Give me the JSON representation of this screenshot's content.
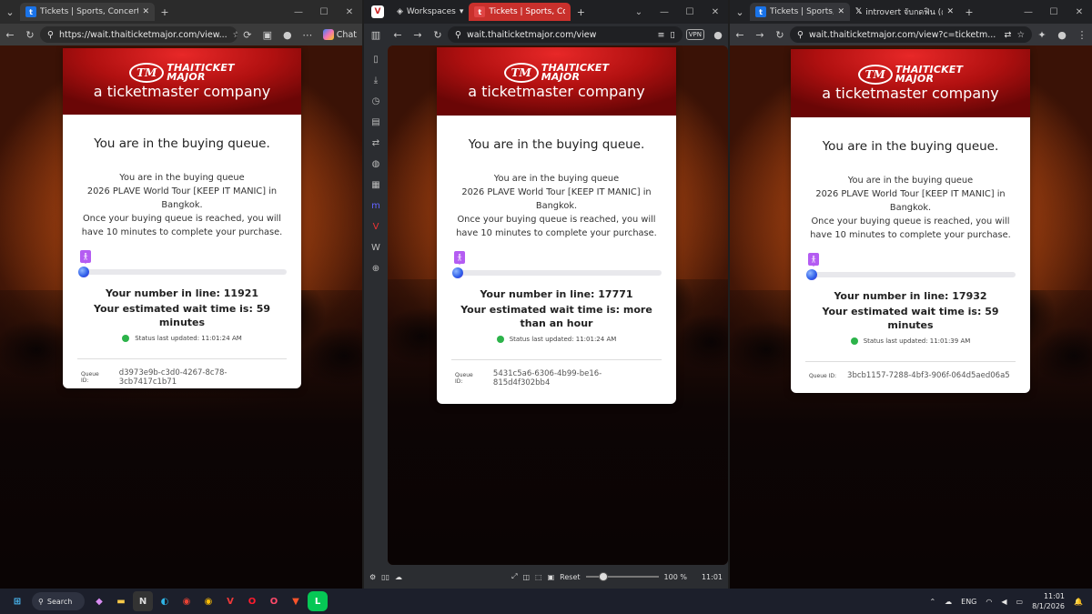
{
  "windows": [
    {
      "id": "edge",
      "tab_title": "Tickets | Sports, Concerts, Festivals",
      "url": "https://wait.thaiticketmajor.com/view...",
      "chat_label": "Chat",
      "queue": {
        "logo_name_line1": "THAITICKET",
        "logo_name_line2": "MAJOR",
        "logo_sub": "a ticketmaster company",
        "title": "You are in the buying queue.",
        "line1": "You are in the buying queue",
        "line2": "2026 PLAVE World Tour [KEEP IT MANIC] in Bangkok.",
        "line3": "Once your buying queue is reached, you will have 10 minutes to complete your purchase.",
        "number_label": "Your number in line: 11921",
        "wait_label": "Your estimated wait time is: 59 minutes",
        "status": "Status last updated: 11:01:24 AM",
        "queue_id_label": "Queue ID:",
        "queue_id": "d3973e9b-c3d0-4267-8c78-3cb7417c1b71",
        "progress": 0.0
      }
    },
    {
      "id": "vivaldi",
      "workspaces_label": "Workspaces",
      "tab_title": "Tickets | Sports, Concerts, F",
      "url": "wait.thaiticketmajor.com/view",
      "vpn_label": "VPN",
      "queue": {
        "logo_name_line1": "THAITICKET",
        "logo_name_line2": "MAJOR",
        "logo_sub": "a ticketmaster company",
        "title": "You are in the buying queue.",
        "line1": "You are in the buying queue",
        "line2": "2026 PLAVE World Tour [KEEP IT MANIC] in Bangkok.",
        "line3": "Once your buying queue is reached, you will have 10 minutes to complete your purchase.",
        "number_label": "Your number in line: 17771",
        "wait_label": "Your estimated wait time is: more than an hour",
        "status": "Status last updated: 11:01:24 AM",
        "queue_id_label": "Queue ID:",
        "queue_id": "5431c5a6-6306-4b99-be16-815d4f302bb4",
        "progress": 0.0
      },
      "statusbar": {
        "reset": "Reset",
        "zoom": "100 %",
        "time": "11:01"
      }
    },
    {
      "id": "chrome",
      "tab_title": "Tickets | Sports, Concer",
      "tab2_title": "introvert จับกดฟิน (@",
      "url": "wait.thaiticketmajor.com/view?c=ticketm...",
      "queue": {
        "logo_name_line1": "THAITICKET",
        "logo_name_line2": "MAJOR",
        "logo_sub": "a ticketmaster company",
        "title": "You are in the buying queue.",
        "line1": "You are in the buying queue",
        "line2": "2026 PLAVE World Tour [KEEP IT MANIC] in Bangkok.",
        "line3": "Once your buying queue is reached, you will have 10 minutes to complete your purchase.",
        "number_label": "Your number in line: 17932",
        "wait_label": "Your estimated wait time is: 59 minutes",
        "status": "Status last updated: 11:01:39 AM",
        "queue_id_label": "Queue ID:",
        "queue_id": "3bcb1157-7288-4bf3-906f-064d5aed06a5",
        "progress": 0.0
      }
    }
  ],
  "taskbar": {
    "search_label": "Search",
    "lang": "ENG",
    "time": "11:01",
    "date": "8/1/2026"
  },
  "colors": {
    "brand_red": "#d41a1a",
    "progress_purple": "#b45cf2",
    "status_green": "#2cb34a"
  }
}
